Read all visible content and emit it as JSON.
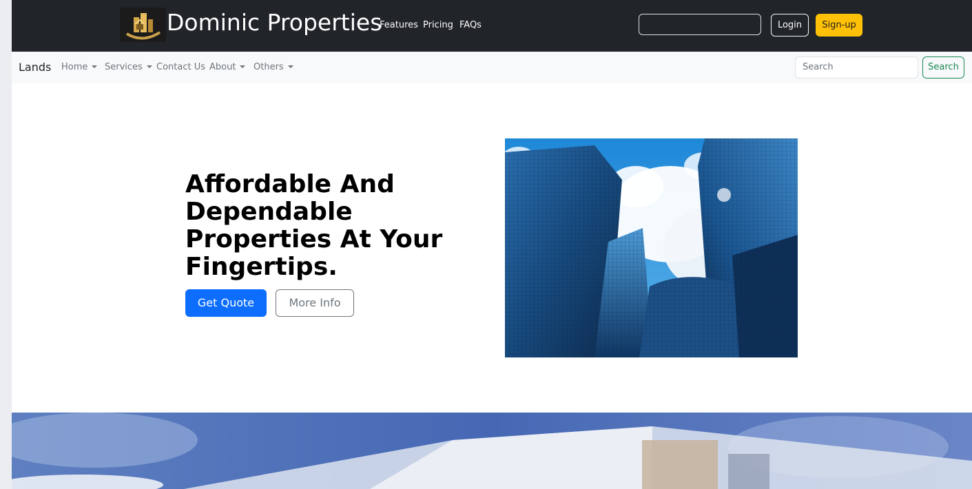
{
  "header": {
    "brand": "Dominic Properties",
    "links": [
      "Features",
      "Pricing",
      "FAQs"
    ],
    "search_value": "",
    "login_label": "Login",
    "signup_label": "Sign-up",
    "signup_color": "#ffc107"
  },
  "navbar": {
    "brand": "Lands",
    "items": [
      {
        "label": "Home",
        "dropdown": true
      },
      {
        "label": "Services",
        "dropdown": true
      },
      {
        "label": "Contact Us",
        "dropdown": false
      },
      {
        "label": "About",
        "dropdown": true
      },
      {
        "label": "Others",
        "dropdown": true
      }
    ],
    "search_placeholder": "Search",
    "search_button": "Search",
    "search_button_color": "#198754"
  },
  "hero": {
    "title": "Affordable And Dependable Properties At Your Fingertips.",
    "primary_button": "Get Quote",
    "secondary_button": "More Info",
    "primary_color": "#0d6efd"
  },
  "icons": {
    "logo": "building-logo-icon",
    "caret": "caret-down-icon"
  }
}
